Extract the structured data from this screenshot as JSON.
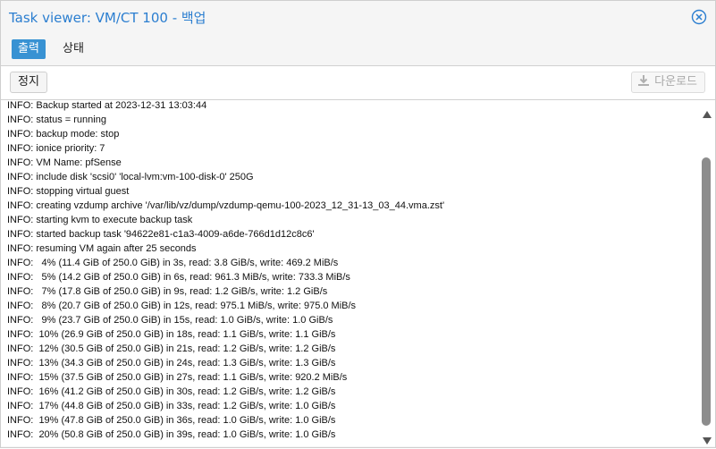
{
  "window": {
    "title": "Task viewer: VM/CT 100 - 백업"
  },
  "tabs": [
    {
      "label": "출력",
      "active": true
    },
    {
      "label": "상태",
      "active": false
    }
  ],
  "toolbar": {
    "stop_label": "정지",
    "download_label": "다운로드"
  },
  "icons": {
    "close": "close-circle-icon",
    "download": "download-icon",
    "scroll_up": "arrow-up-icon",
    "scroll_down": "arrow-down-icon"
  },
  "colors": {
    "title": "#2b7ed0",
    "active_tab_bg": "#3892d3",
    "scroll_thumb": "#8c8c8c"
  },
  "log": [
    "INFO: Backup started at 2023-12-31 13:03:44",
    "INFO: status = running",
    "INFO: backup mode: stop",
    "INFO: ionice priority: 7",
    "INFO: VM Name: pfSense",
    "INFO: include disk 'scsi0' 'local-lvm:vm-100-disk-0' 250G",
    "INFO: stopping virtual guest",
    "INFO: creating vzdump archive '/var/lib/vz/dump/vzdump-qemu-100-2023_12_31-13_03_44.vma.zst'",
    "INFO: starting kvm to execute backup task",
    "INFO: started backup task '94622e81-c1a3-4009-a6de-766d1d12c8c6'",
    "INFO: resuming VM again after 25 seconds",
    "INFO:   4% (11.4 GiB of 250.0 GiB) in 3s, read: 3.8 GiB/s, write: 469.2 MiB/s",
    "INFO:   5% (14.2 GiB of 250.0 GiB) in 6s, read: 961.3 MiB/s, write: 733.3 MiB/s",
    "INFO:   7% (17.8 GiB of 250.0 GiB) in 9s, read: 1.2 GiB/s, write: 1.2 GiB/s",
    "INFO:   8% (20.7 GiB of 250.0 GiB) in 12s, read: 975.1 MiB/s, write: 975.0 MiB/s",
    "INFO:   9% (23.7 GiB of 250.0 GiB) in 15s, read: 1.0 GiB/s, write: 1.0 GiB/s",
    "INFO:  10% (26.9 GiB of 250.0 GiB) in 18s, read: 1.1 GiB/s, write: 1.1 GiB/s",
    "INFO:  12% (30.5 GiB of 250.0 GiB) in 21s, read: 1.2 GiB/s, write: 1.2 GiB/s",
    "INFO:  13% (34.3 GiB of 250.0 GiB) in 24s, read: 1.3 GiB/s, write: 1.3 GiB/s",
    "INFO:  15% (37.5 GiB of 250.0 GiB) in 27s, read: 1.1 GiB/s, write: 920.2 MiB/s",
    "INFO:  16% (41.2 GiB of 250.0 GiB) in 30s, read: 1.2 GiB/s, write: 1.2 GiB/s",
    "INFO:  17% (44.8 GiB of 250.0 GiB) in 33s, read: 1.2 GiB/s, write: 1.0 GiB/s",
    "INFO:  19% (47.8 GiB of 250.0 GiB) in 36s, read: 1.0 GiB/s, write: 1.0 GiB/s",
    "INFO:  20% (50.8 GiB of 250.0 GiB) in 39s, read: 1.0 GiB/s, write: 1.0 GiB/s"
  ]
}
